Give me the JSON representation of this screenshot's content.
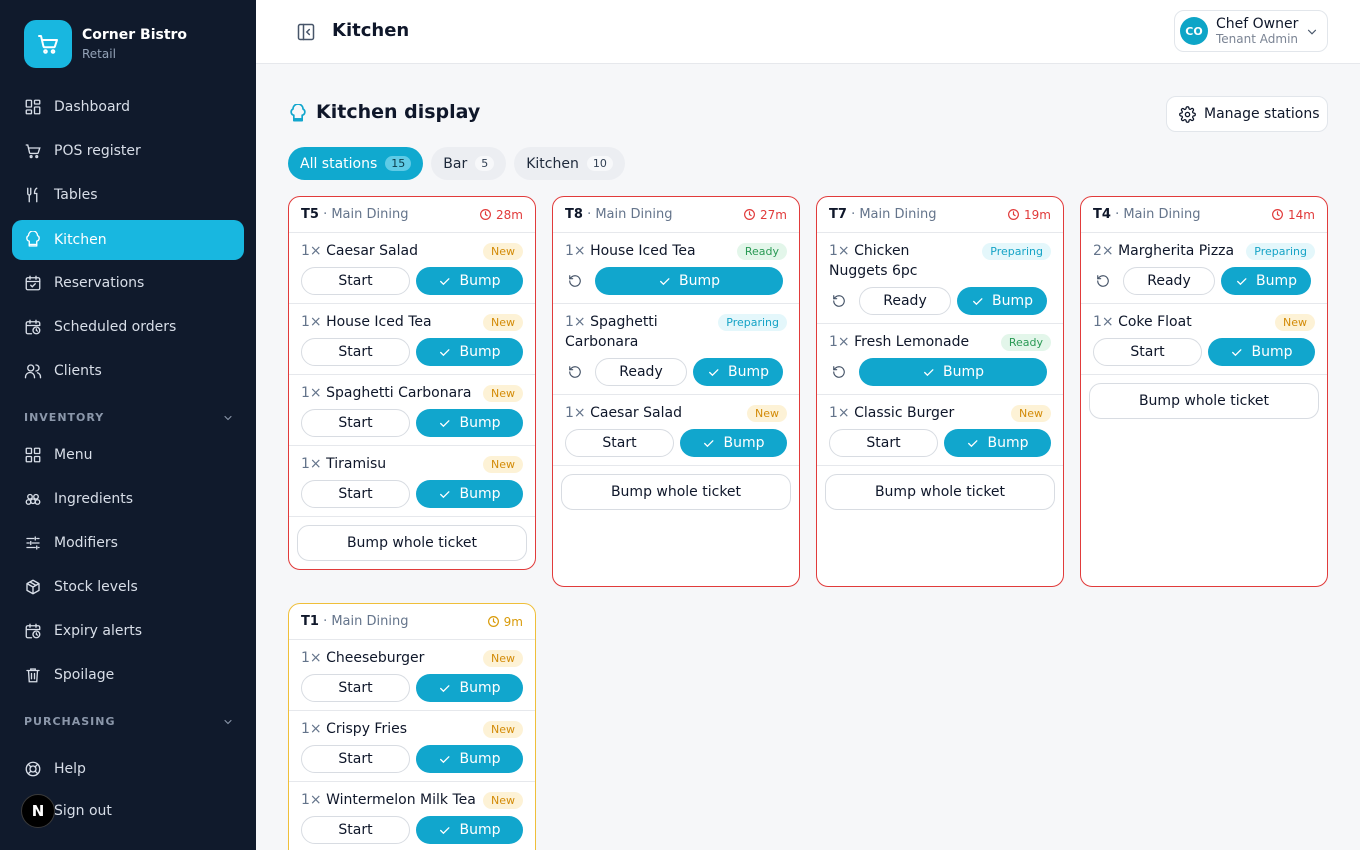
{
  "brand": {
    "name": "Corner Bistro",
    "subtitle": "Retail"
  },
  "nav": {
    "dashboard": "Dashboard",
    "pos": "POS register",
    "tables": "Tables",
    "kitchen": "Kitchen",
    "reservations": "Reservations",
    "scheduled": "Scheduled orders",
    "clients": "Clients",
    "inventory_section": "INVENTORY",
    "menu": "Menu",
    "ingredients": "Ingredients",
    "modifiers": "Modifiers",
    "stock": "Stock levels",
    "expiry": "Expiry alerts",
    "spoilage": "Spoilage",
    "purchasing_section": "PURCHASING",
    "help": "Help",
    "signout": "Sign out"
  },
  "dev_badge": "N",
  "topbar": {
    "title": "Kitchen"
  },
  "user": {
    "initials": "CO",
    "name": "Chef Owner",
    "role": "Tenant Admin"
  },
  "page": {
    "title": "Kitchen display",
    "manage_label": "Manage stations"
  },
  "filters": [
    {
      "label": "All stations",
      "count": "15"
    },
    {
      "label": "Bar",
      "count": "5"
    },
    {
      "label": "Kitchen",
      "count": "10"
    }
  ],
  "labels": {
    "start": "Start",
    "ready": "Ready",
    "bump": "Bump",
    "bump_whole": "Bump whole ticket"
  },
  "tickets": [
    {
      "table": "T5",
      "area": "· Main Dining",
      "elapsed": "28m",
      "items": [
        {
          "qty": "1×",
          "name": "Caesar Salad",
          "status": "New"
        },
        {
          "qty": "1×",
          "name": "House Iced Tea",
          "status": "New"
        },
        {
          "qty": "1×",
          "name": "Spaghetti Carbonara",
          "status": "New"
        },
        {
          "qty": "1×",
          "name": "Tiramisu",
          "status": "New"
        }
      ]
    },
    {
      "table": "T8",
      "area": "· Main Dining",
      "elapsed": "27m",
      "items": [
        {
          "qty": "1×",
          "name": "House Iced Tea",
          "status": "Ready"
        },
        {
          "qty": "1×",
          "name": "Spaghetti Carbonara",
          "status": "Preparing"
        },
        {
          "qty": "1×",
          "name": "Caesar Salad",
          "status": "New"
        }
      ]
    },
    {
      "table": "T7",
      "area": "· Main Dining",
      "elapsed": "19m",
      "items": [
        {
          "qty": "1×",
          "name": "Chicken Nuggets 6pc",
          "status": "Preparing"
        },
        {
          "qty": "1×",
          "name": "Fresh Lemonade",
          "status": "Ready"
        },
        {
          "qty": "1×",
          "name": "Classic Burger",
          "status": "New"
        }
      ]
    },
    {
      "table": "T4",
      "area": "· Main Dining",
      "elapsed": "14m",
      "items": [
        {
          "qty": "2×",
          "name": "Margherita Pizza",
          "status": "Preparing"
        },
        {
          "qty": "1×",
          "name": "Coke Float",
          "status": "New"
        }
      ]
    },
    {
      "table": "T1",
      "area": "· Main Dining",
      "elapsed": "9m",
      "items": [
        {
          "qty": "1×",
          "name": "Cheeseburger",
          "status": "New"
        },
        {
          "qty": "1×",
          "name": "Crispy Fries",
          "status": "New"
        },
        {
          "qty": "1×",
          "name": "Wintermelon Milk Tea",
          "status": "New"
        }
      ]
    }
  ]
}
